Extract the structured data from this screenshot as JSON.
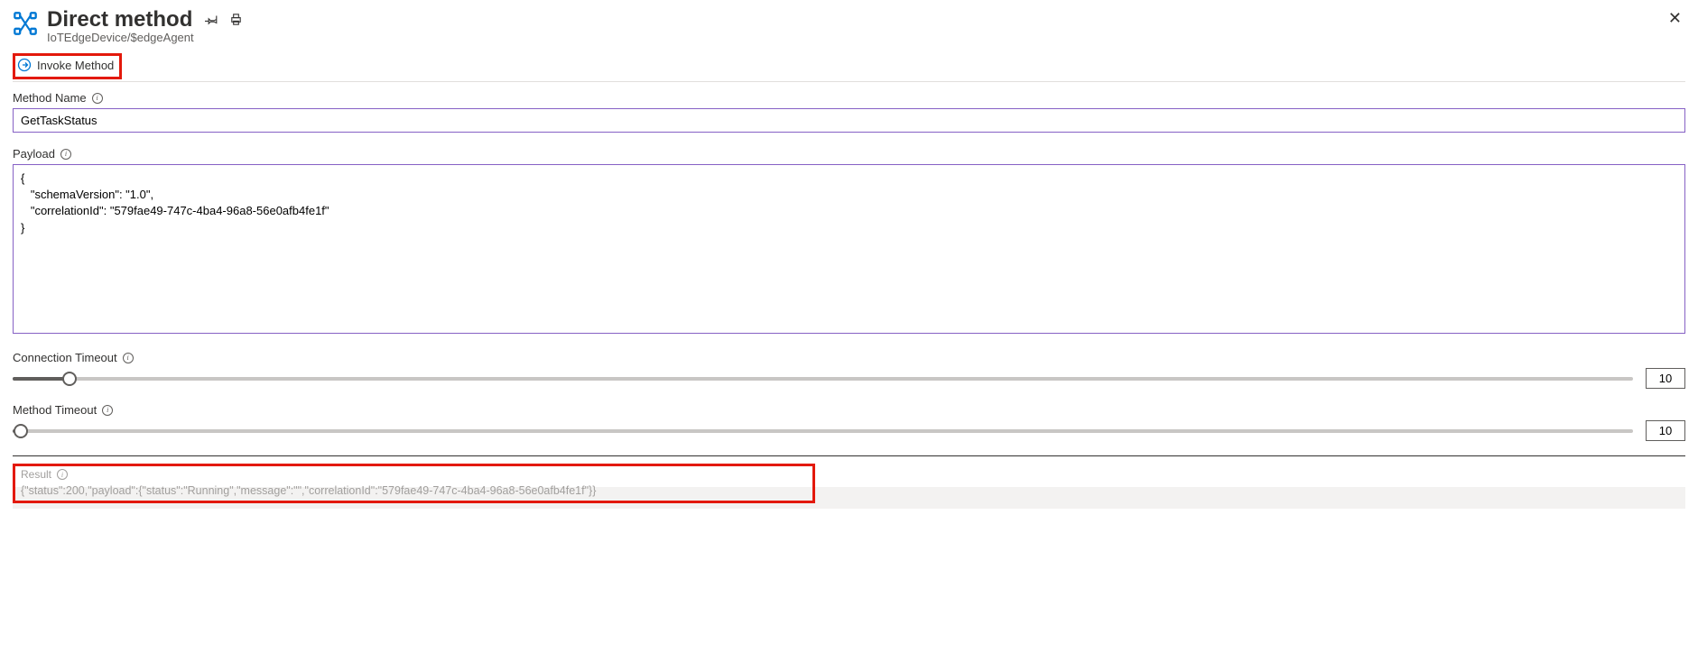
{
  "header": {
    "title": "Direct method",
    "breadcrumb": "IoTEdgeDevice/$edgeAgent"
  },
  "toolbar": {
    "invoke_label": "Invoke Method"
  },
  "form": {
    "method_name": {
      "label": "Method Name",
      "value": "GetTaskStatus"
    },
    "payload": {
      "label": "Payload",
      "value": "{\n   \"schemaVersion\": \"1.0\",\n   \"correlationId\": \"579fae49-747c-4ba4-96a8-56e0afb4fe1f\"\n}"
    },
    "connection_timeout": {
      "label": "Connection Timeout",
      "value": "10",
      "percent": 3.5
    },
    "method_timeout": {
      "label": "Method Timeout",
      "value": "10",
      "percent": 0.5
    }
  },
  "result": {
    "label": "Result",
    "text": "{\"status\":200,\"payload\":{\"status\":\"Running\",\"message\":\"\",\"correlationId\":\"579fae49-747c-4ba4-96a8-56e0afb4fe1f\"}}"
  }
}
